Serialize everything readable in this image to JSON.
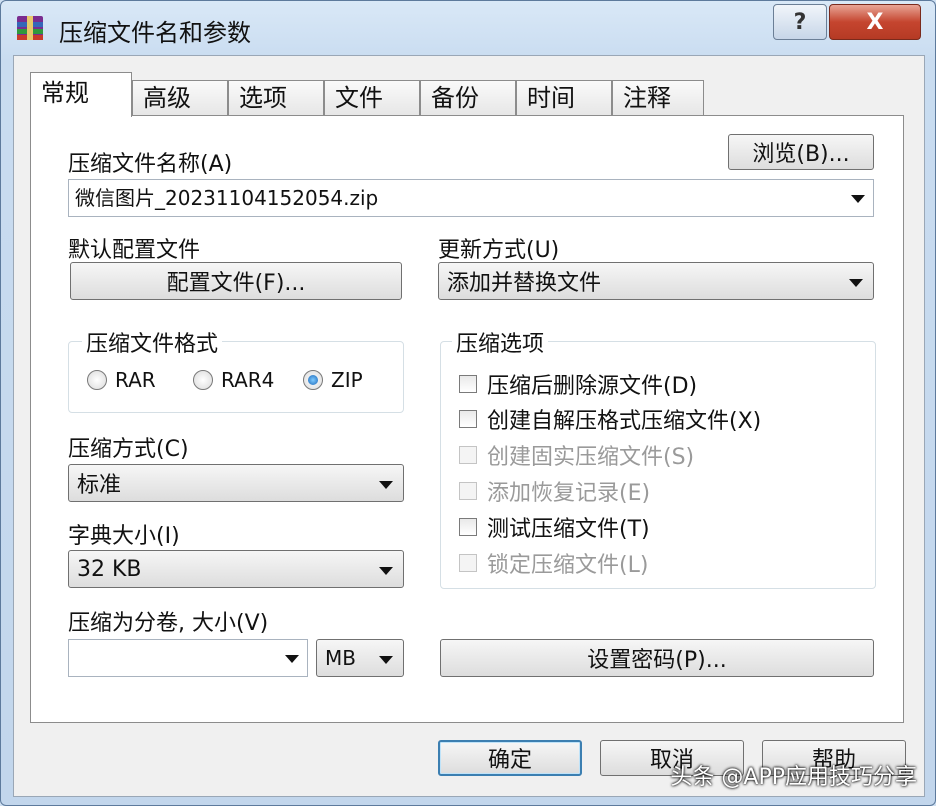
{
  "window": {
    "title": "压缩文件名和参数",
    "help_label": "?",
    "close_label": "X"
  },
  "tabs": [
    {
      "label": "常规"
    },
    {
      "label": "高级"
    },
    {
      "label": "选项"
    },
    {
      "label": "文件"
    },
    {
      "label": "备份"
    },
    {
      "label": "时间"
    },
    {
      "label": "注释"
    }
  ],
  "general": {
    "archive_name_label": "压缩文件名称(A)",
    "browse_label": "浏览(B)...",
    "archive_name_value": "微信图片_20231104152054.zip",
    "default_profile_label": "默认配置文件",
    "profiles_button": "配置文件(F)...",
    "update_mode_label": "更新方式(U)",
    "update_mode_value": "添加并替换文件",
    "format_group_title": "压缩文件格式",
    "formats": [
      "RAR",
      "RAR4",
      "ZIP"
    ],
    "selected_format": "ZIP",
    "method_label": "压缩方式(C)",
    "method_value": "标准",
    "dict_label": "字典大小(I)",
    "dict_value": "32 KB",
    "split_label": "压缩为分卷, 大小(V)",
    "split_value": "",
    "split_unit": "MB",
    "options_group_title": "压缩选项",
    "options": [
      {
        "label": "压缩后删除源文件(D)",
        "checked": false,
        "enabled": true
      },
      {
        "label": "创建自解压格式压缩文件(X)",
        "checked": false,
        "enabled": true
      },
      {
        "label": "创建固实压缩文件(S)",
        "checked": false,
        "enabled": false
      },
      {
        "label": "添加恢复记录(E)",
        "checked": false,
        "enabled": false
      },
      {
        "label": "测试压缩文件(T)",
        "checked": false,
        "enabled": true
      },
      {
        "label": "锁定压缩文件(L)",
        "checked": false,
        "enabled": false
      }
    ],
    "password_button": "设置密码(P)..."
  },
  "buttons": {
    "ok": "确定",
    "cancel": "取消",
    "help": "帮助"
  },
  "watermark": "头条 @APP应用技巧分享"
}
